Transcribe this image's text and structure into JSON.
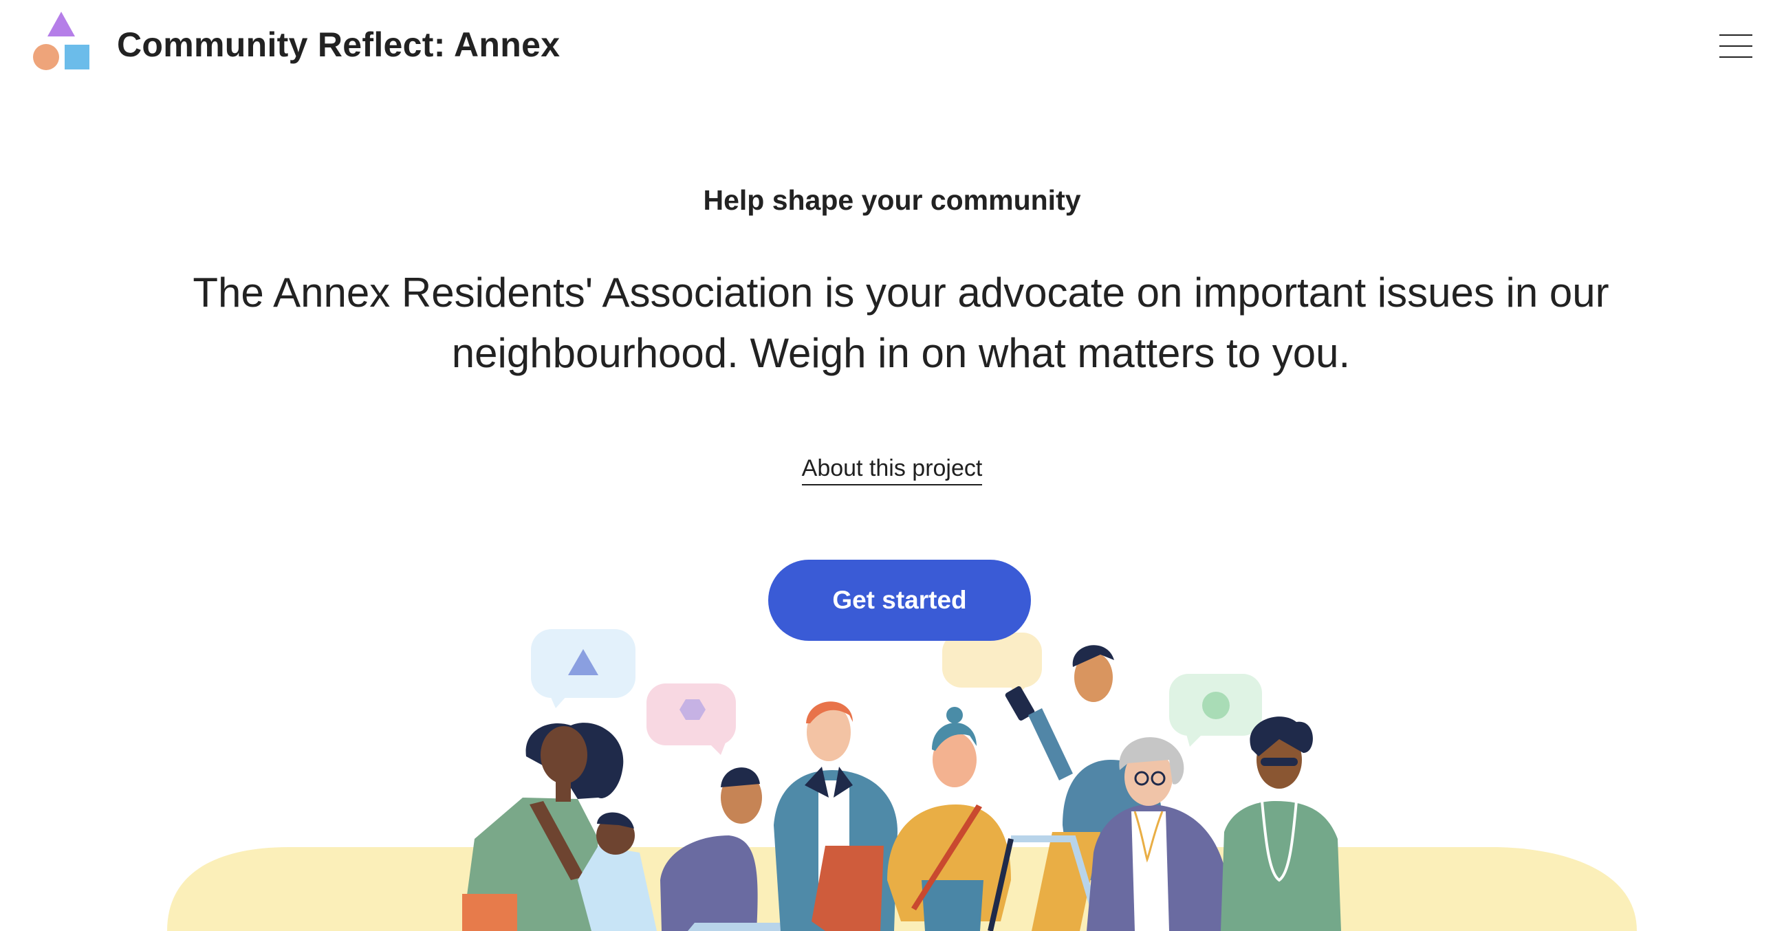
{
  "header": {
    "title": "Community Reflect: Annex",
    "menu_icon": "hamburger-menu-icon"
  },
  "hero": {
    "eyebrow": "Help shape your community",
    "lead": "The Annex Residents' Association is your advocate on important issues in our neighbourhood. Weigh in on what matters to you.",
    "about_link": "About this project",
    "cta": "Get started"
  },
  "colors": {
    "accent": "#3a5bd6",
    "logo_triangle": "#b57ee8",
    "logo_circle": "#eea47a",
    "logo_square": "#6bbcea",
    "ground": "#fbefb9"
  }
}
